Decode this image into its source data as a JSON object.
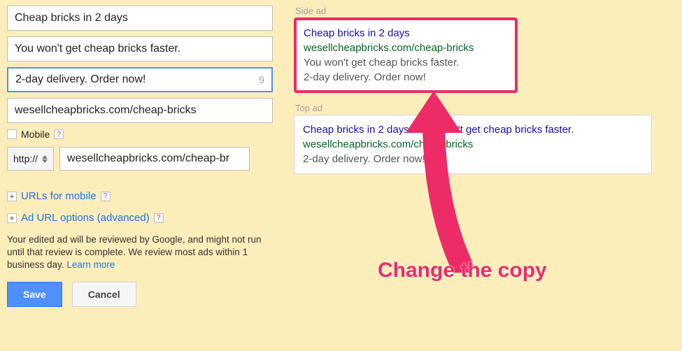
{
  "form": {
    "headline1": "Cheap bricks in 2 days",
    "headline2": "You won't get cheap bricks faster.",
    "description": "2-day delivery. Order now!",
    "description_counter": "9",
    "display_url": "wesellcheapbricks.com/cheap-bricks",
    "mobile_label": "Mobile",
    "protocol": "http://",
    "final_url": "wesellcheapbricks.com/cheap-br"
  },
  "expanders": {
    "mobile_urls": "URLs for mobile",
    "ad_url_options": "Ad URL options (advanced)"
  },
  "note": {
    "text": "Your edited ad will be reviewed by Google, and might not run until that review is complete. We review most ads within 1 business day.",
    "link": "Learn more"
  },
  "buttons": {
    "save": "Save",
    "cancel": "Cancel"
  },
  "preview": {
    "side_label": "Side ad",
    "top_label": "Top ad",
    "side": {
      "title": "Cheap bricks in 2 days",
      "url": "wesellcheapbricks.com/cheap-bricks",
      "line1": "You won't get cheap bricks faster.",
      "line2": "2-day delivery. Order now!"
    },
    "top": {
      "title": "Cheap bricks in 2 days - You won't get cheap bricks faster.",
      "url": "wesellcheapbricks.com/cheap-bricks",
      "line1": "2-day delivery. Order now!"
    }
  },
  "annotation": "Change the copy"
}
